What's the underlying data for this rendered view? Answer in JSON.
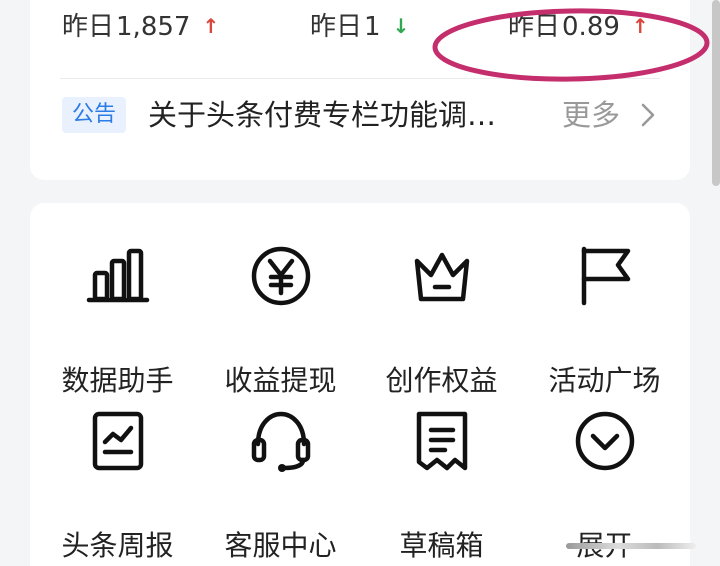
{
  "stats": [
    {
      "prefix": "昨日",
      "value": "1,857",
      "trend": "up",
      "arrow": "↑"
    },
    {
      "prefix": "昨日",
      "value": "1",
      "trend": "down",
      "arrow": "↓"
    },
    {
      "prefix": "昨日",
      "value": "0.89",
      "trend": "up",
      "arrow": "↑"
    }
  ],
  "notice": {
    "tag": "公告",
    "text": "关于头条付费专栏功能调…",
    "more": "更多"
  },
  "tools": [
    {
      "label": "数据助手",
      "icon": "bar-chart-icon"
    },
    {
      "label": "收益提现",
      "icon": "yen-coin-icon"
    },
    {
      "label": "创作权益",
      "icon": "crown-icon"
    },
    {
      "label": "活动广场",
      "icon": "flag-icon"
    },
    {
      "label": "头条周报",
      "icon": "weekly-report-icon"
    },
    {
      "label": "客服中心",
      "icon": "headset-icon"
    },
    {
      "label": "草稿箱",
      "icon": "draft-box-icon"
    },
    {
      "label": "展开",
      "icon": "chevron-down-circle-icon"
    }
  ],
  "colors": {
    "up": "#d9463c",
    "down": "#2fa84f",
    "tag_bg": "#e8f1fd",
    "tag_text": "#2d7be5",
    "annotation": "#c42e6c"
  }
}
